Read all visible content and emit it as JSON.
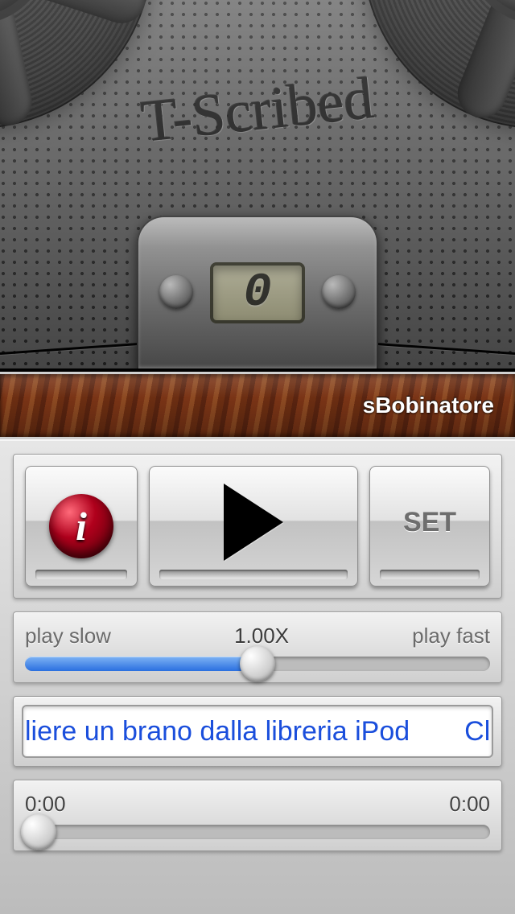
{
  "deck": {
    "logo": "T-Scribed",
    "counter": "0"
  },
  "wood": {
    "app_name": "sBobinatore"
  },
  "buttons": {
    "info_glyph": "i",
    "set_label": "SET"
  },
  "speed": {
    "slow_label": "play slow",
    "value_label": "1.00X",
    "fast_label": "play fast",
    "fill_percent": 50
  },
  "marquee": {
    "text": "liere un brano dalla libreria iPod  Clic"
  },
  "time": {
    "current": "0:00",
    "total": "0:00",
    "fill_percent": 0
  }
}
